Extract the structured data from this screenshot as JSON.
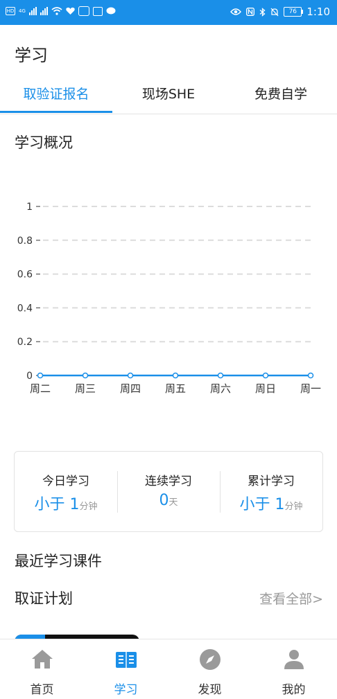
{
  "status_bar": {
    "left_badges": [
      "HD",
      "4G"
    ],
    "battery": "76",
    "time": "1:10",
    "accent": "#1a8fe8"
  },
  "page": {
    "title": "学习"
  },
  "tabs": [
    {
      "label": "取验证报名",
      "active": true
    },
    {
      "label": "现场SHE",
      "active": false
    },
    {
      "label": "免费自学",
      "active": false
    }
  ],
  "overview": {
    "title": "学习概况"
  },
  "chart_data": {
    "type": "line",
    "categories": [
      "周二",
      "周三",
      "周四",
      "周五",
      "周六",
      "周日",
      "周一"
    ],
    "values": [
      0,
      0,
      0,
      0,
      0,
      0,
      0
    ],
    "y_ticks": [
      "0",
      "0.2",
      "0.4",
      "0.6",
      "0.8",
      "1"
    ],
    "ylim": [
      0,
      1
    ],
    "grid": true,
    "color": "#1a8fe8"
  },
  "stats": [
    {
      "label": "今日学习",
      "value_prefix": "小于 ",
      "value": "1",
      "unit": "分钟"
    },
    {
      "label": "连续学习",
      "value_prefix": "",
      "value": "0",
      "unit": "天"
    },
    {
      "label": "累计学习",
      "value_prefix": "小于 ",
      "value": "1",
      "unit": "分钟"
    }
  ],
  "recent": {
    "title": "最近学习课件"
  },
  "plan": {
    "title": "取证计划",
    "view_all": "查看全部>"
  },
  "bottom_nav": [
    {
      "label": "首页",
      "icon": "home-icon",
      "active": false
    },
    {
      "label": "学习",
      "icon": "book-icon",
      "active": true
    },
    {
      "label": "发现",
      "icon": "compass-icon",
      "active": false
    },
    {
      "label": "我的",
      "icon": "user-icon",
      "active": false
    }
  ]
}
